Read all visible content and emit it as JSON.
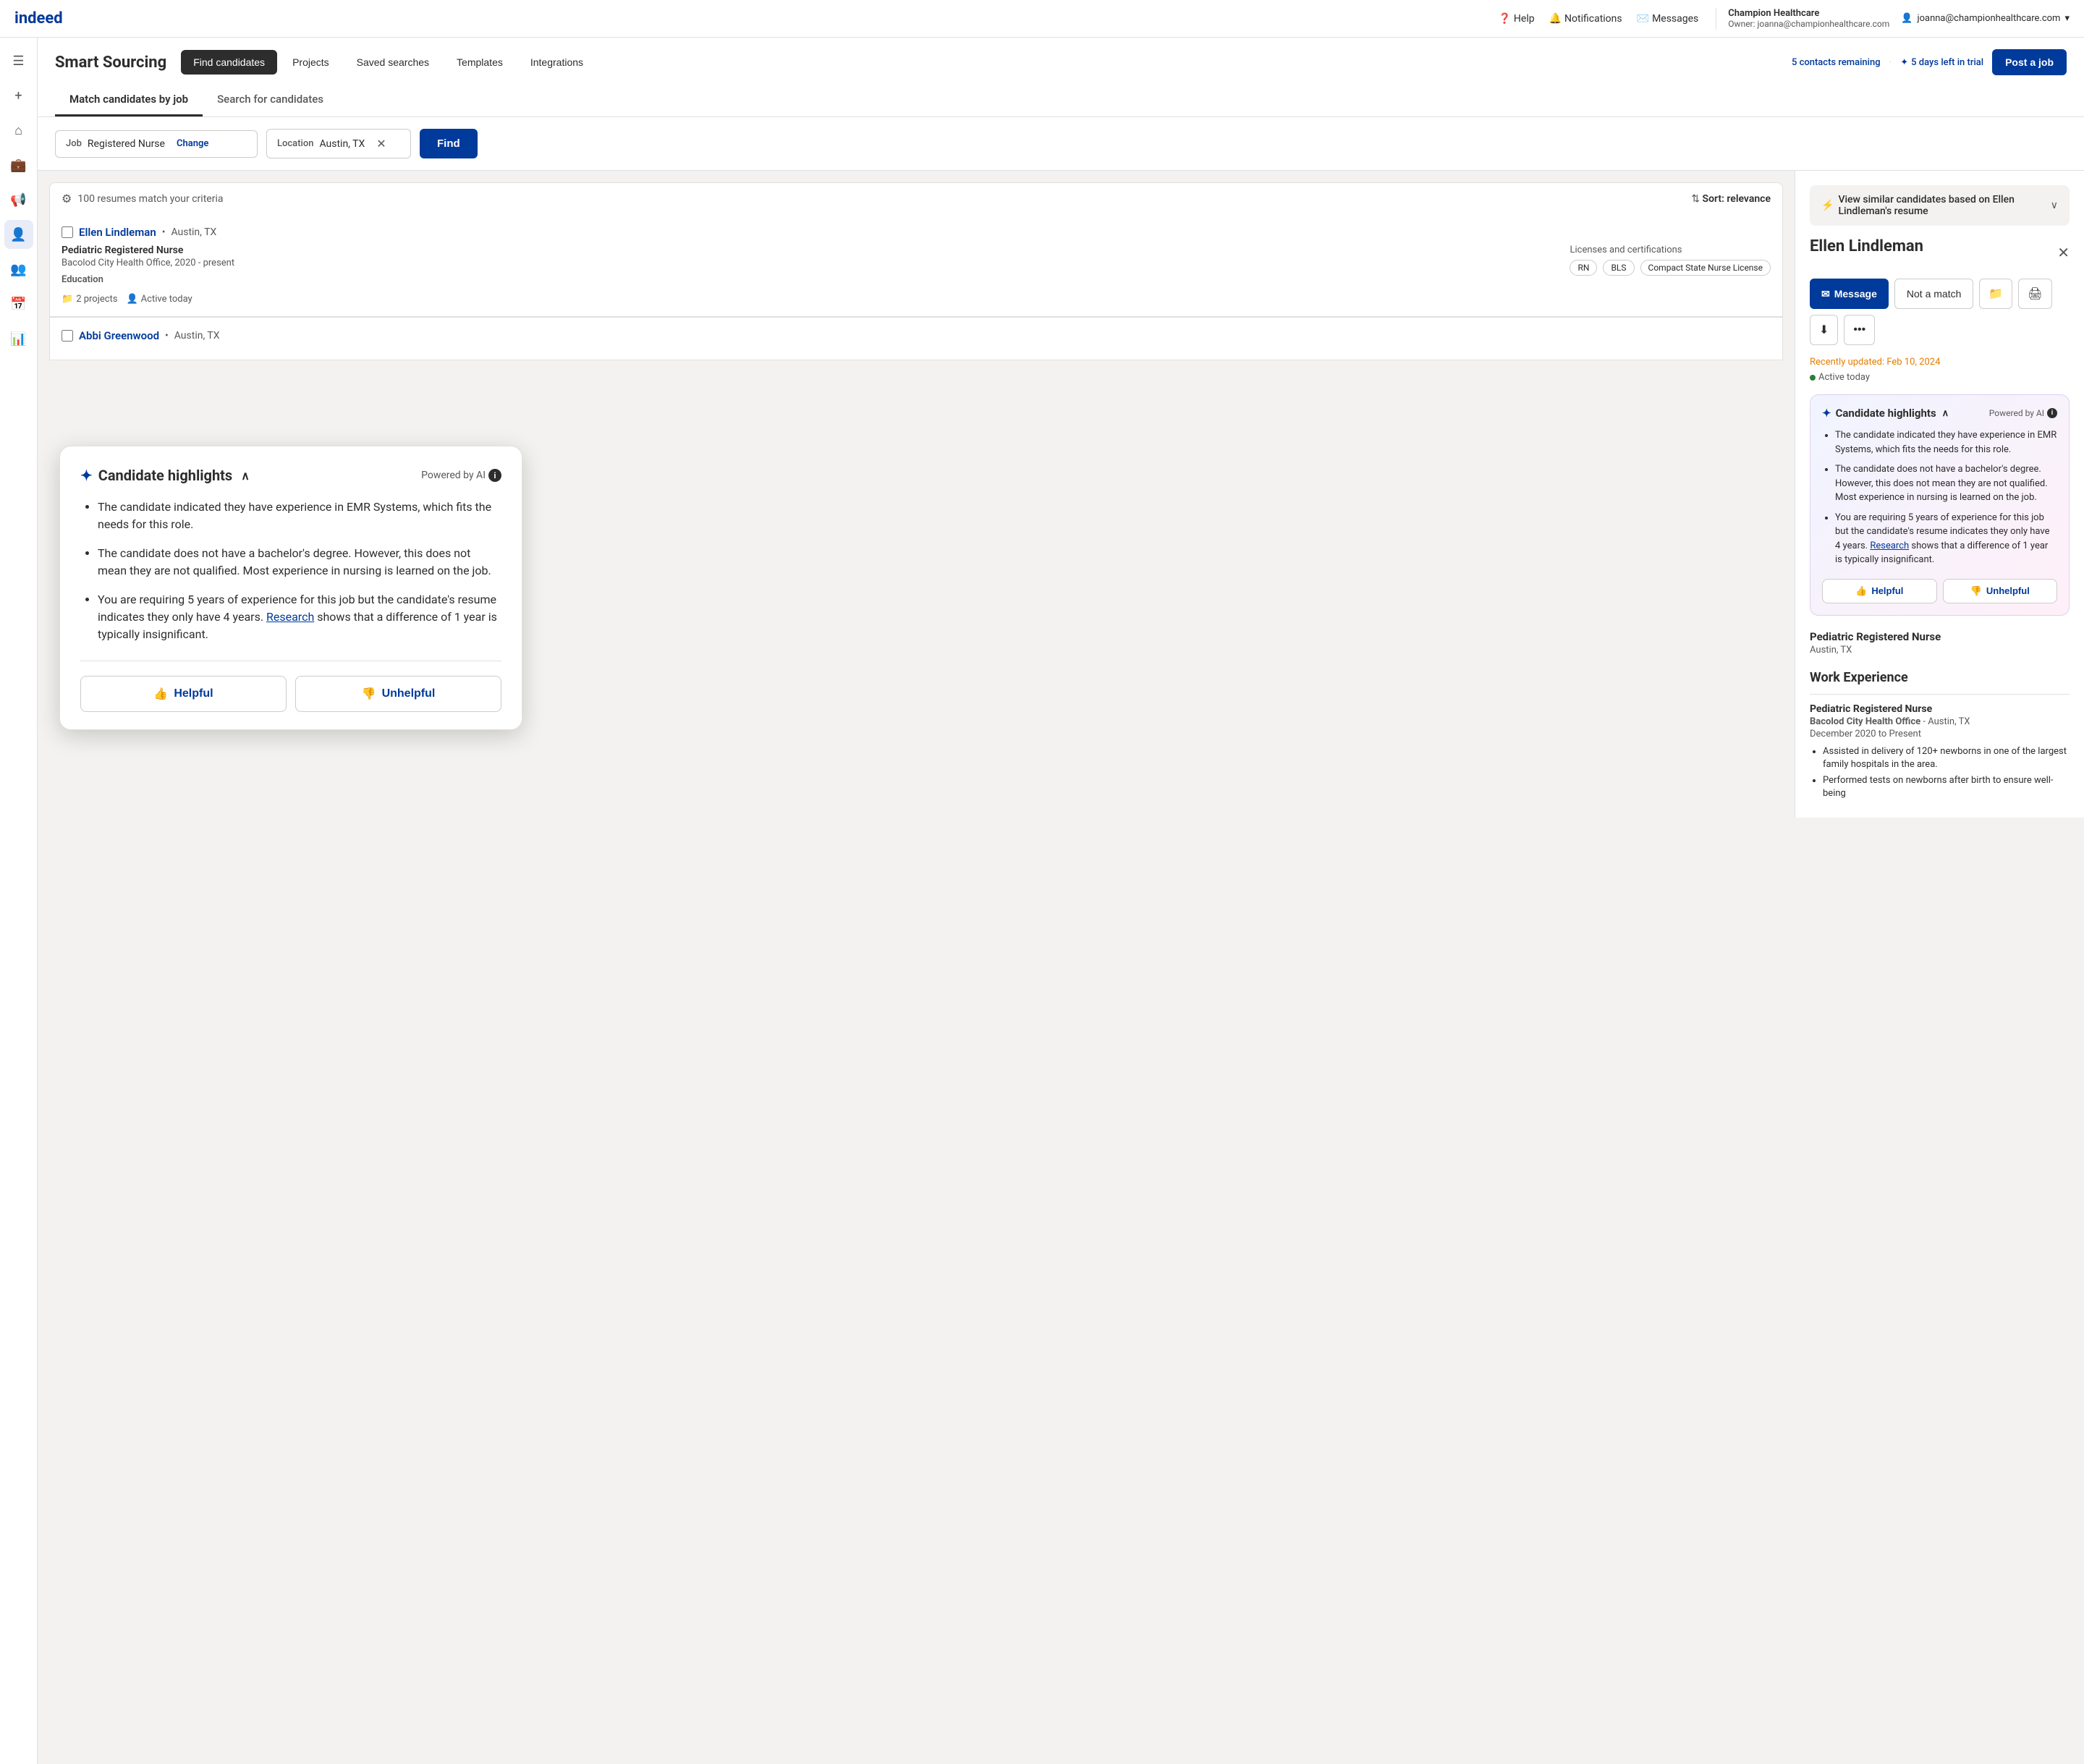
{
  "topnav": {
    "logo": "indeed",
    "help_label": "Help",
    "notifications_label": "Notifications",
    "messages_label": "Messages",
    "company_name": "Champion Healthcare",
    "company_owner": "Owner: joanna@championhealthcare.com",
    "user_email": "joanna@championhealthcare.com"
  },
  "sidebar": {
    "icons": [
      "☰",
      "+",
      "⌂",
      "💼",
      "📢",
      "👤",
      "👥",
      "📅",
      "📊"
    ]
  },
  "smart_sourcing": {
    "title": "Smart Sourcing",
    "nav_buttons": [
      {
        "label": "Find candidates",
        "active": true
      },
      {
        "label": "Projects",
        "active": false
      },
      {
        "label": "Saved searches",
        "active": false
      },
      {
        "label": "Templates",
        "active": false
      },
      {
        "label": "Integrations",
        "active": false
      }
    ],
    "contacts_remaining": "5 contacts remaining",
    "trial_label": "5 days left in trial",
    "post_job_label": "Post a job"
  },
  "tabs": [
    {
      "label": "Match candidates by job",
      "active": true
    },
    {
      "label": "Search for candidates",
      "active": false
    }
  ],
  "search": {
    "job_label": "Job",
    "job_value": "Registered Nurse",
    "change_label": "Change",
    "location_label": "Location",
    "location_value": "Austin, TX",
    "find_label": "Find"
  },
  "results": {
    "count_text": "100 resumes match your criteria",
    "sort_text": "Sort: relevance"
  },
  "candidate1": {
    "name": "Ellen Lindleman",
    "location": "Austin, TX",
    "job_title": "Pediatric Registered Nurse",
    "company": "Bacolod City Health Office, 2020 - present",
    "certs_label": "Licenses and certifications",
    "certs": [
      "RN",
      "BLS",
      "Compact State Nurse License"
    ],
    "education_label": "Education",
    "projects_count": "2 projects",
    "active_status": "Active today"
  },
  "candidate2": {
    "name": "Abbi Greenwood",
    "location": "Austin, TX"
  },
  "ai_popup": {
    "title": "Candidate highlights",
    "powered_label": "Powered by AI",
    "bullets": [
      "The candidate indicated they have experience in EMR Systems, which fits the needs for this role.",
      "The candidate does not have a bachelor's degree. However, this does not mean they are not qualified. Most experience in nursing is learned on the job.",
      "You are requiring 5 years of experience for this job but the candidate's resume indicates they only have 4 years. Research shows that a difference of 1 year is typically insignificant."
    ],
    "research_link": "Research",
    "helpful_label": "Helpful",
    "unhelpful_label": "Unhelpful"
  },
  "right_panel": {
    "view_similar_text": "View similar candidates based on Ellen Lindleman's resume",
    "candidate_name": "Ellen Lindleman",
    "message_label": "Message",
    "not_match_label": "Not a match",
    "updated_text": "Recently updated:",
    "updated_date": "Feb 10, 2024",
    "active_text": "Active today",
    "ai_section": {
      "title": "Candidate highlights",
      "powered_label": "Powered by AI",
      "bullets": [
        "The candidate indicated they have experience in EMR Systems, which fits the needs for this role.",
        "The candidate does not have a bachelor's degree. However, this does not mean they are not qualified. Most experience in nursing is learned on the job.",
        "You are requiring 5 years of experience for this job but the candidate's resume indicates they only have 4 years. Research shows that a difference of 1 year is typically insignificant."
      ],
      "research_link": "Research",
      "helpful_label": "Helpful",
      "unhelpful_label": "Unhelpful"
    },
    "job_title": "Pediatric Registered Nurse",
    "job_location": "Austin, TX",
    "work_exp_label": "Work Experience",
    "exp_title": "Pediatric Registered Nurse",
    "exp_company": "Bacolod City Health Office",
    "exp_location": "Austin, TX",
    "exp_dates": "December 2020 to Present",
    "exp_bullets": [
      "Assisted in delivery of 120+ newborns in one of the largest family hospitals in the area.",
      "Performed tests on newborns after birth to ensure well-being"
    ]
  }
}
